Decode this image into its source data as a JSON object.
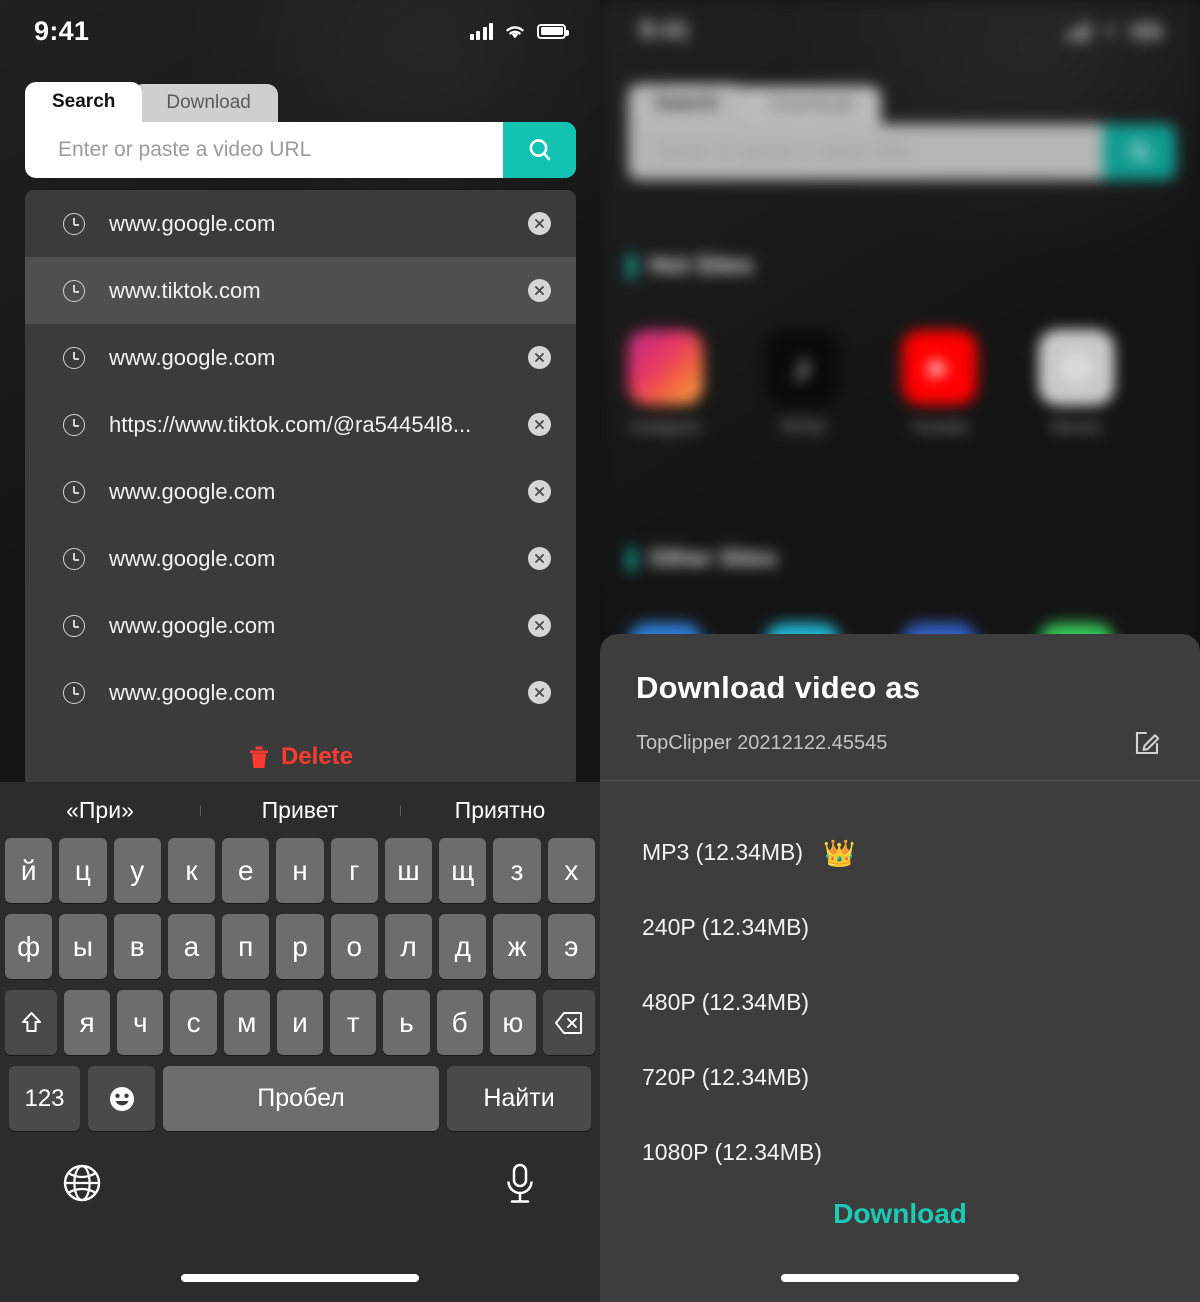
{
  "left": {
    "status": {
      "time": "9:41",
      "signal_icon": "signal-bars-icon",
      "wifi_icon": "wifi-icon",
      "battery_icon": "battery-icon"
    },
    "tabs": [
      {
        "label": "Search",
        "active": true
      },
      {
        "label": "Download",
        "active": false
      }
    ],
    "search": {
      "placeholder": "Enter or paste a video URL",
      "value": "",
      "button_icon": "search-icon"
    },
    "history": {
      "items": [
        {
          "text": "www.google.com",
          "selected": false
        },
        {
          "text": "www.tiktok.com",
          "selected": true
        },
        {
          "text": "www.google.com",
          "selected": false
        },
        {
          "text": "https://www.tiktok.com/@ra54454l8...",
          "selected": false
        },
        {
          "text": "www.google.com",
          "selected": false
        },
        {
          "text": "www.google.com",
          "selected": false
        },
        {
          "text": "www.google.com",
          "selected": false
        },
        {
          "text": "www.google.com",
          "selected": false
        }
      ],
      "delete_label": "Delete",
      "delete_icon": "trash-icon",
      "item_icon": "history-clock-icon",
      "remove_icon": "close-circle-icon"
    },
    "keyboard": {
      "suggestions": [
        "«При»",
        "Привет",
        "Приятно"
      ],
      "row1": [
        "й",
        "ц",
        "у",
        "к",
        "е",
        "н",
        "г",
        "ш",
        "щ",
        "з",
        "х"
      ],
      "row2": [
        "ф",
        "ы",
        "в",
        "а",
        "п",
        "р",
        "о",
        "л",
        "д",
        "ж",
        "э"
      ],
      "row3": [
        "я",
        "ч",
        "с",
        "м",
        "и",
        "т",
        "ь",
        "б",
        "ю"
      ],
      "shift_icon": "shift-icon",
      "backspace_icon": "backspace-icon",
      "numbers_label": "123",
      "emoji_icon": "emoji-icon",
      "space_label": "Пробел",
      "enter_label": "Найти",
      "globe_icon": "globe-icon",
      "mic_icon": "microphone-icon"
    }
  },
  "right": {
    "status": {
      "time": "9:41"
    },
    "tabs": [
      {
        "label": "Search",
        "active": true
      },
      {
        "label": "Download",
        "active": false
      }
    ],
    "search": {
      "placeholder": "Enter or paste a video URL",
      "button_icon": "search-icon"
    },
    "hot_sites": {
      "title": "Hot Sites",
      "items": [
        {
          "label": "Instagram",
          "icon": "instagram-icon"
        },
        {
          "label": "TikTok",
          "icon": "tiktok-icon"
        },
        {
          "label": "Youtube",
          "icon": "youtube-icon"
        },
        {
          "label": "Movies",
          "icon": "movies-icon"
        }
      ]
    },
    "other_sites": {
      "title": "Other Sites"
    },
    "sheet": {
      "title": "Download video as",
      "filename": "TopClipper 20212122.45545",
      "edit_icon": "edit-pencil-icon",
      "options": [
        {
          "label": "MP3 (12.34MB)",
          "premium": true,
          "badge": "👑"
        },
        {
          "label": "240P (12.34MB)",
          "premium": false
        },
        {
          "label": "480P (12.34MB)",
          "premium": false
        },
        {
          "label": "720P (12.34MB)",
          "premium": false
        },
        {
          "label": "1080P (12.34MB)",
          "premium": false
        }
      ],
      "download_label": "Download"
    }
  },
  "colors": {
    "accent": "#13c3b2",
    "download_link": "#19cbb6",
    "delete_red": "#ff3b30",
    "sheet_bg": "#3d3d3d",
    "list_bg": "#3b3b3b",
    "list_selected": "#4f4f4f"
  }
}
